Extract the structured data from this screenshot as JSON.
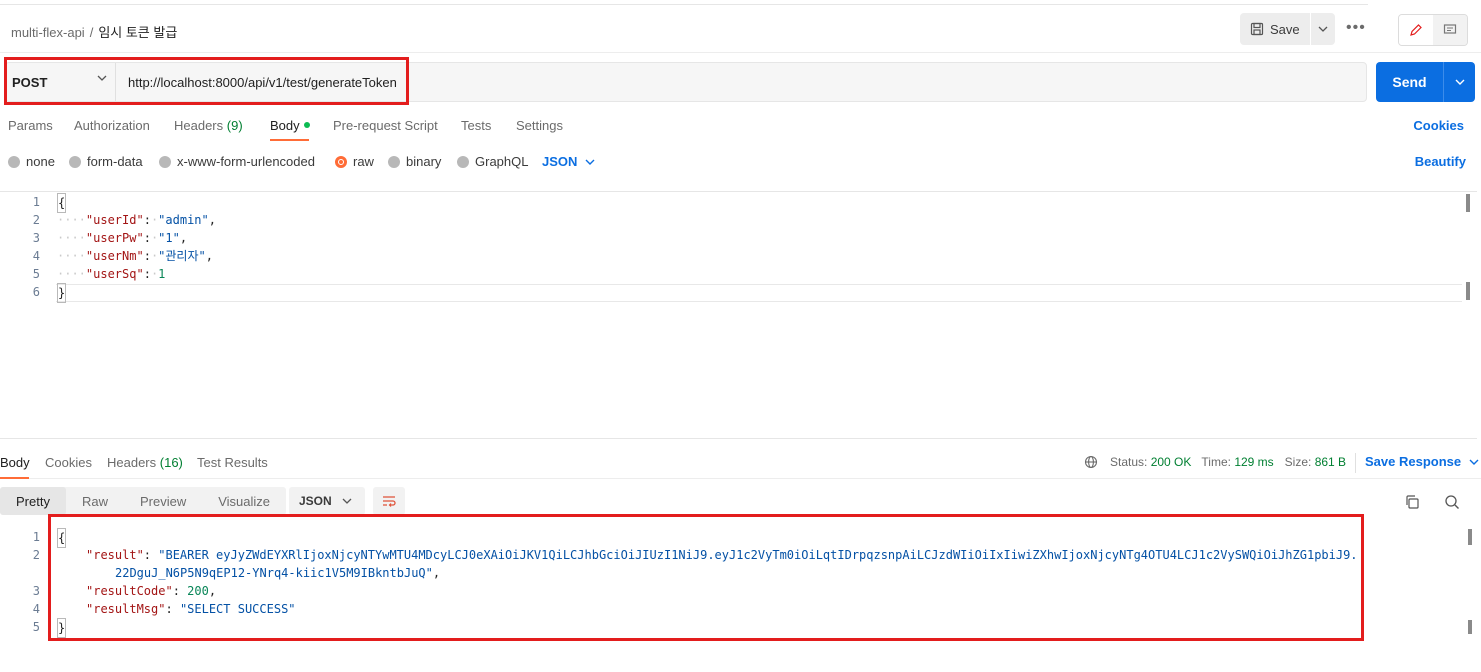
{
  "breadcrumb": {
    "collection": "multi-flex-api",
    "separator": "/",
    "request_name": "임시 토큰 발급"
  },
  "toolbar": {
    "save_label": "Save",
    "more_label": "•••"
  },
  "request": {
    "method": "POST",
    "url": "http://localhost:8000/api/v1/test/generateToken",
    "send_label": "Send"
  },
  "request_tabs": {
    "params": "Params",
    "authorization": "Authorization",
    "headers": "Headers",
    "headers_count": "(9)",
    "body": "Body",
    "pre_request": "Pre-request Script",
    "tests": "Tests",
    "settings": "Settings",
    "cookies": "Cookies"
  },
  "body_types": {
    "none": "none",
    "form_data": "form-data",
    "urlencoded": "x-www-form-urlencoded",
    "raw": "raw",
    "binary": "binary",
    "graphql": "GraphQL",
    "language": "JSON",
    "beautify": "Beautify"
  },
  "request_body": {
    "line_numbers": [
      "1",
      "2",
      "3",
      "4",
      "5",
      "6"
    ],
    "open": "{",
    "close": "}",
    "fields": [
      {
        "key": "\"userId\"",
        "value": "\"admin\"",
        "type": "str",
        "comma": ","
      },
      {
        "key": "\"userPw\"",
        "value": "\"1\"",
        "type": "str",
        "comma": ","
      },
      {
        "key": "\"userNm\"",
        "value": "\"관리자\"",
        "type": "str",
        "comma": ","
      },
      {
        "key": "\"userSq\"",
        "value": "1",
        "type": "num",
        "comma": ""
      }
    ]
  },
  "response_tabs": {
    "body": "Body",
    "cookies": "Cookies",
    "headers": "Headers",
    "headers_count": "(16)",
    "test_results": "Test Results"
  },
  "response_meta": {
    "status_label": "Status:",
    "status_value": "200 OK",
    "time_label": "Time:",
    "time_value": "129 ms",
    "size_label": "Size:",
    "size_value": "861 B",
    "save_response": "Save Response"
  },
  "response_format": {
    "pretty": "Pretty",
    "raw": "Raw",
    "preview": "Preview",
    "visualize": "Visualize",
    "language": "JSON"
  },
  "response_body": {
    "line_numbers": [
      "1",
      "2",
      "3",
      "4",
      "5"
    ],
    "open": "{",
    "close": "}",
    "result_key": "\"result\"",
    "result_value_line1": "\"BEARER eyJyZWdEYXRlIjoxNjcyNTYwMTU4MDcyLCJ0eXAiOiJKV1QiLCJhbGciOiJIUzI1NiJ9.eyJ1c2VyTm0iOiLqtIDrpqzsnpAiLCJzdWIiOiIxIiwiZXhwIjoxNjcyNTg4OTU4LCJ1c2VySWQiOiJhZG1pbiJ9.",
    "result_value_line2": "22DguJ_N6P5N9qEP12-YNrq4-kiic1V5M9IBkntbJuQ\"",
    "result_code_key": "\"resultCode\"",
    "result_code_value": "200",
    "result_msg_key": "\"resultMsg\"",
    "result_msg_value": "\"SELECT SUCCESS\""
  },
  "colors": {
    "accent": "#ff6c37",
    "primary": "#0b6ee1",
    "highlight": "#e31d1d",
    "status_ok": "#007f31"
  }
}
